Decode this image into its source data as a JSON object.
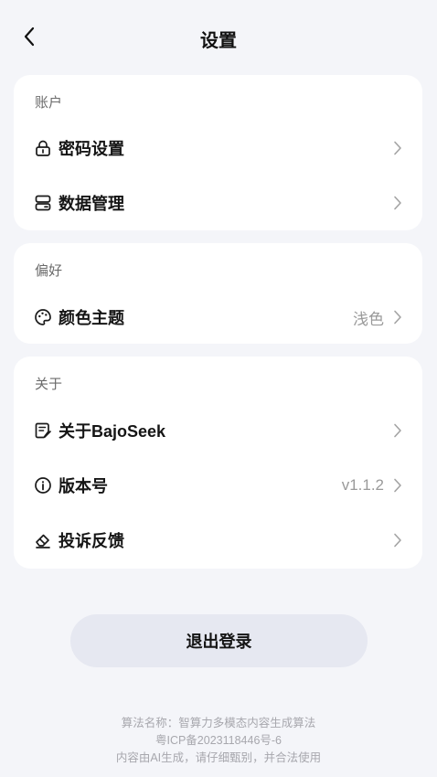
{
  "header": {
    "title": "设置",
    "back_icon": "chevron-left-icon"
  },
  "account": {
    "title": "账户",
    "items": [
      {
        "label": "密码设置",
        "icon": "lock-icon"
      },
      {
        "label": "数据管理",
        "icon": "database-icon"
      }
    ]
  },
  "preferences": {
    "title": "偏好",
    "items": [
      {
        "label": "颜色主题",
        "value": "浅色",
        "icon": "palette-icon"
      }
    ]
  },
  "about": {
    "title": "关于",
    "items": [
      {
        "label": "关于BajoSeek",
        "icon": "document-icon"
      },
      {
        "label": "版本号",
        "value": "v1.1.2",
        "icon": "info-icon"
      },
      {
        "label": "投诉反馈",
        "icon": "eraser-icon"
      }
    ]
  },
  "logout_label": "退出登录",
  "footer": {
    "line1": "算法名称：智算力多模态内容生成算法",
    "line2": "粤ICP备2023118446号-6",
    "line3": "内容由AI生成，请仔细甄别，并合法使用"
  },
  "colors": {
    "background": "#f4f5f9",
    "card": "#ffffff",
    "logout_button": "#e6e8f1",
    "muted_text": "#9a9a9a"
  }
}
